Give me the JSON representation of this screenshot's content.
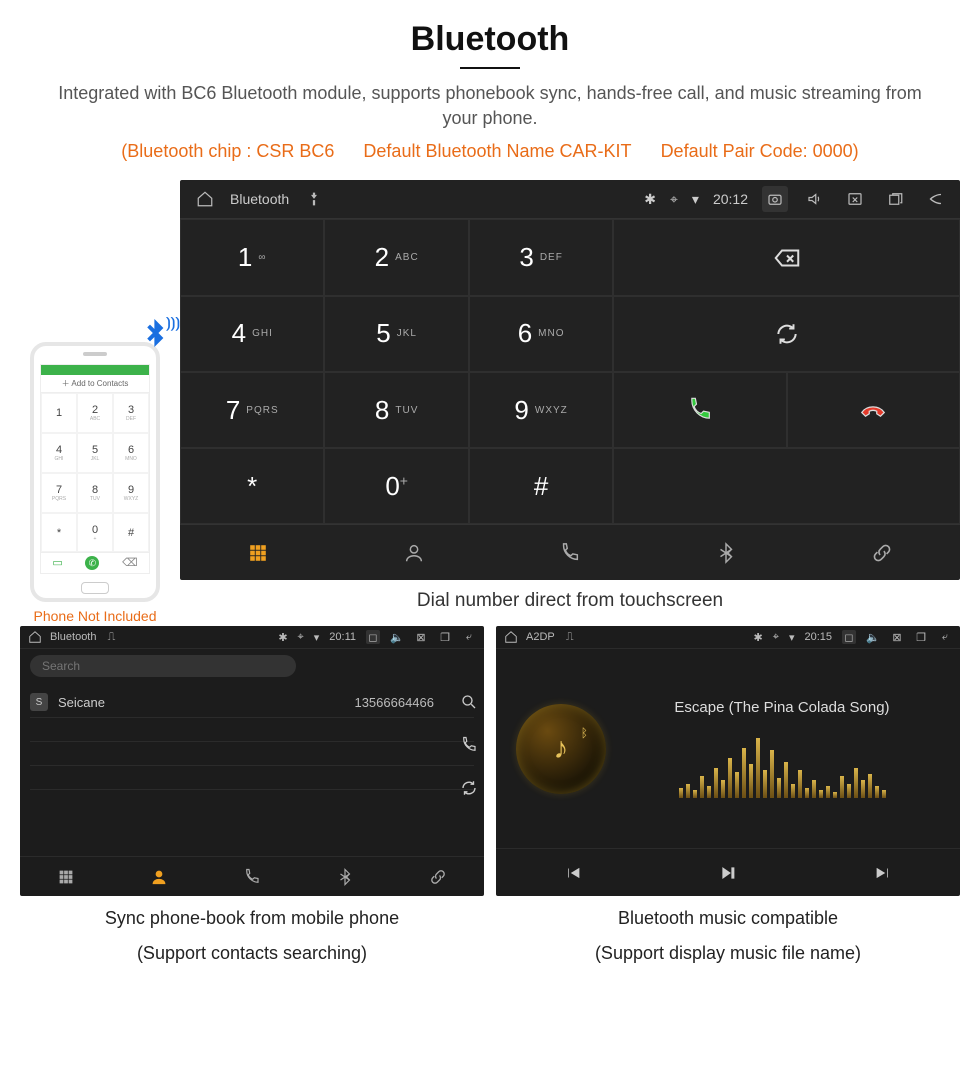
{
  "title": "Bluetooth",
  "description": "Integrated with BC6 Bluetooth module, supports phonebook sync, hands-free call, and music streaming from your phone.",
  "spec": {
    "chip": "(Bluetooth chip : CSR BC6",
    "name": "Default Bluetooth Name CAR-KIT",
    "pair": "Default Pair Code: 0000)"
  },
  "phone": {
    "add_contacts": "＋  Add to Contacts",
    "keys": [
      {
        "n": "1",
        "s": ""
      },
      {
        "n": "2",
        "s": "ABC"
      },
      {
        "n": "3",
        "s": "DEF"
      },
      {
        "n": "4",
        "s": "GHI"
      },
      {
        "n": "5",
        "s": "JKL"
      },
      {
        "n": "6",
        "s": "MNO"
      },
      {
        "n": "7",
        "s": "PQRS"
      },
      {
        "n": "8",
        "s": "TUV"
      },
      {
        "n": "9",
        "s": "WXYZ"
      },
      {
        "n": "*",
        "s": ""
      },
      {
        "n": "0",
        "s": "+"
      },
      {
        "n": "#",
        "s": ""
      }
    ],
    "caption": "Phone Not Included"
  },
  "head_unit": {
    "status": {
      "title": "Bluetooth",
      "time": "20:12"
    },
    "keys": [
      {
        "n": "1",
        "s": "∞"
      },
      {
        "n": "2",
        "s": "ABC"
      },
      {
        "n": "3",
        "s": "DEF"
      },
      {
        "n": "4",
        "s": "GHI"
      },
      {
        "n": "5",
        "s": "JKL"
      },
      {
        "n": "6",
        "s": "MNO"
      },
      {
        "n": "7",
        "s": "PQRS"
      },
      {
        "n": "8",
        "s": "TUV"
      },
      {
        "n": "9",
        "s": "WXYZ"
      },
      {
        "n": "*",
        "s": ""
      },
      {
        "n": "0",
        "s": "+"
      },
      {
        "n": "#",
        "s": ""
      }
    ],
    "caption": "Dial number direct from touchscreen"
  },
  "phonebook": {
    "status": {
      "title": "Bluetooth",
      "time": "20:11"
    },
    "search_placeholder": "Search",
    "contacts": [
      {
        "initial": "S",
        "name": "Seicane",
        "number": "13566664466"
      }
    ],
    "caption_line1": "Sync phone-book from mobile phone",
    "caption_line2": "(Support contacts searching)"
  },
  "music": {
    "status": {
      "title": "A2DP",
      "time": "20:15"
    },
    "song": "Escape (The Pina Colada Song)",
    "eq_heights": [
      10,
      14,
      8,
      22,
      12,
      30,
      18,
      40,
      26,
      50,
      34,
      60,
      28,
      48,
      20,
      36,
      14,
      28,
      10,
      18,
      8,
      12,
      6,
      22,
      14,
      30,
      18,
      24,
      12,
      8
    ],
    "caption_line1": "Bluetooth music compatible",
    "caption_line2": "(Support display music file name)"
  }
}
